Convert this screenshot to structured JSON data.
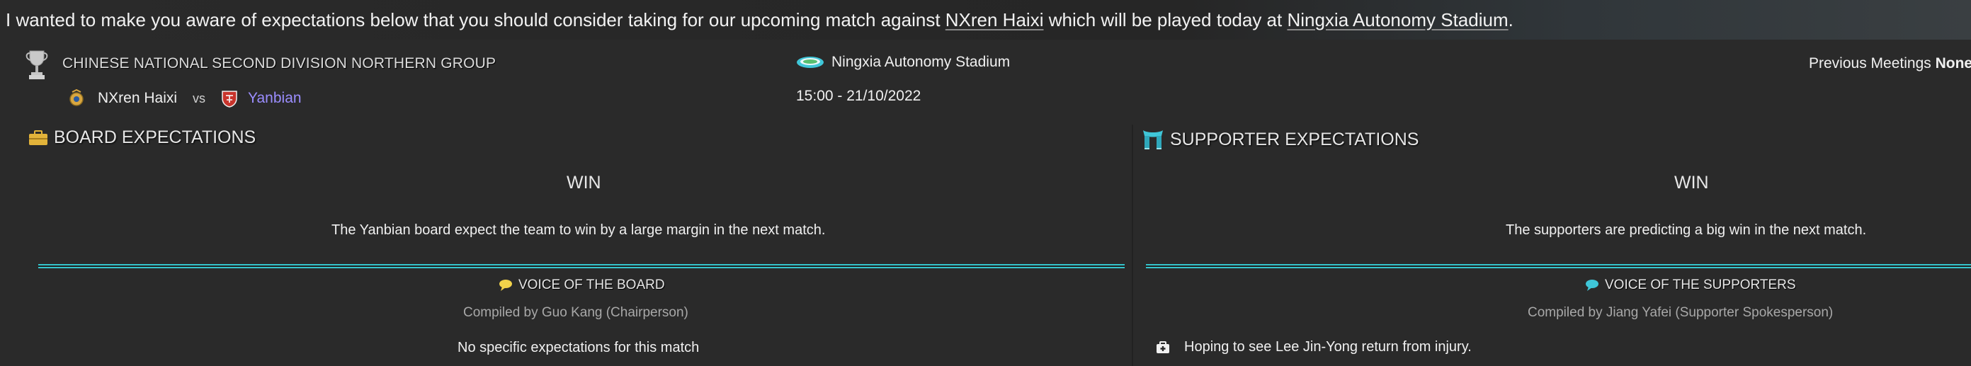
{
  "intro": {
    "pre": "I wanted to make you aware of expectations below that you should consider taking for our upcoming match against ",
    "opponent": "NXren Haixi",
    "mid": " which will be played today at ",
    "venue": "Ningxia Autonomy Stadium",
    "post": "."
  },
  "match": {
    "competition": "CHINESE NATIONAL SECOND DIVISION NORTHERN GROUP",
    "home_team": "NXren Haixi",
    "vs": "vs",
    "away_team": "Yanbian",
    "stadium": "Ningxia Autonomy Stadium",
    "datetime": "15:00 - 21/10/2022",
    "previous_meetings_label": "Previous Meetings",
    "previous_meetings_value": "None"
  },
  "board": {
    "title": "BOARD EXPECTATIONS",
    "result": "WIN",
    "description": "The Yanbian board expect the team to win by a large margin in the next match.",
    "voice_title": "VOICE OF THE BOARD",
    "compiled_by": "Compiled by Guo Kang (Chairperson)",
    "note": "No specific expectations for this match"
  },
  "supporters": {
    "title": "SUPPORTER EXPECTATIONS",
    "result": "WIN",
    "description": "The supporters are predicting a big win in the next match.",
    "voice_title": "VOICE OF THE SUPPORTERS",
    "compiled_by": "Compiled by Jiang Yafei (Supporter Spokesperson)",
    "note": "Hoping to see Lee Jin-Yong return from injury."
  },
  "icons": {
    "trophy": "trophy-icon",
    "home_badge": "club-badge-icon",
    "away_badge": "club-badge-icon",
    "stadium": "stadium-icon",
    "board": "briefcase-icon",
    "supporters": "scarf-icon",
    "board_voice": "speech-bubble-icon",
    "supporters_voice": "speech-bubble-icon",
    "injury": "medical-kit-icon"
  },
  "colors": {
    "accent_teal": "#35c4cc",
    "away_team": "#9b8dff",
    "board_bubble": "#f2d34a",
    "supporters_bubble": "#3fc6d8"
  }
}
